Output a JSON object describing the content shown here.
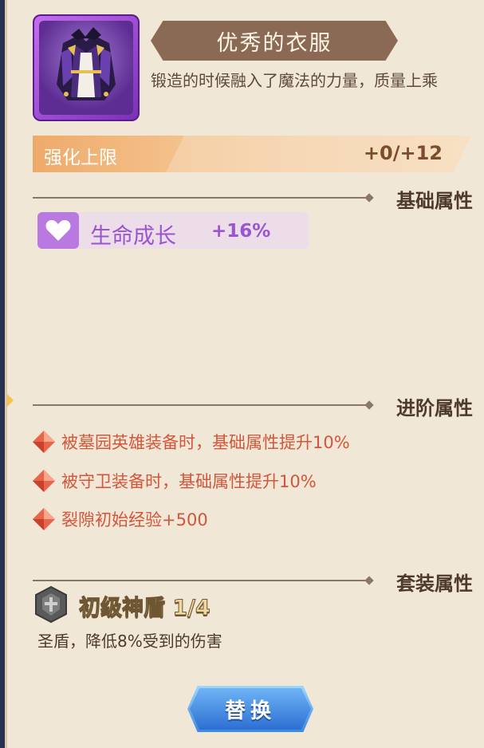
{
  "item": {
    "name": "优秀的衣服",
    "description": "锻造的时候融入了魔法的力量，质量上乘",
    "icon": "purple-armor-coat-icon"
  },
  "enhance": {
    "label": "强化上限",
    "value": "+0/+12"
  },
  "sections": {
    "base_title": "基础属性",
    "advanced_title": "进阶属性",
    "set_title": "套装属性"
  },
  "base_attribute": {
    "icon": "heart-up-icon",
    "name": "生命成长",
    "value": "+16%"
  },
  "advanced_attributes": [
    {
      "icon": "red-gem-icon",
      "text": "被墓园英雄装备时，基础属性提升10%"
    },
    {
      "icon": "red-gem-icon",
      "text": "被守卫装备时，基础属性提升10%"
    },
    {
      "icon": "red-gem-icon",
      "text": "裂隙初始经验+500"
    }
  ],
  "set": {
    "icon": "shield-icon",
    "name": "初级神盾 1/4",
    "description": "圣盾，降低8%受到的伤害"
  },
  "actions": {
    "replace_label": "替换"
  },
  "colors": {
    "panel_bg": "#f1e7d7",
    "title_ribbon": "#8a6a55",
    "base_attr_text": "#9a55d0",
    "advanced_text": "#d2563a",
    "button_blue": "#3f88e0"
  }
}
